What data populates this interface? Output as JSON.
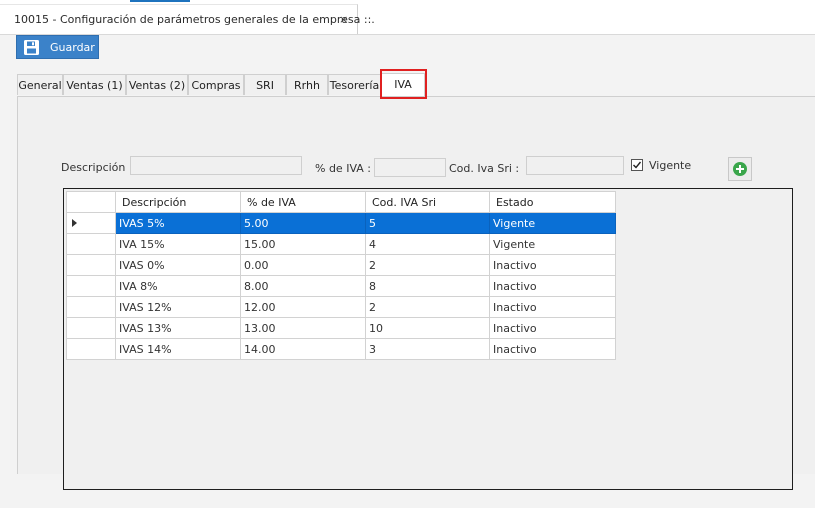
{
  "document_tab": {
    "title": "10015 - Configuración de parámetros generales de la empresa ::.",
    "close_glyph": "×"
  },
  "toolbar": {
    "save_label": "Guardar"
  },
  "tabs": [
    {
      "label": "General"
    },
    {
      "label": "Ventas (1)"
    },
    {
      "label": "Ventas (2)"
    },
    {
      "label": "Compras"
    },
    {
      "label": "SRI"
    },
    {
      "label": "Rrhh"
    },
    {
      "label": "Tesorería"
    },
    {
      "label": "IVA"
    }
  ],
  "active_tab": "IVA",
  "form": {
    "descripcion_label": "Descripción :",
    "descripcion_value": "",
    "iva_label": "% de IVA :",
    "iva_value": "",
    "cod_label": "Cod. Iva Sri :",
    "cod_value": "",
    "vigente_label": "Vigente",
    "vigente_checked": true
  },
  "grid": {
    "columns": [
      "Descripción",
      "% de IVA",
      "Cod. IVA Sri",
      "Estado"
    ],
    "rows": [
      {
        "descripcion": "IVAS 5%",
        "iva": "5.00",
        "cod": "5",
        "estado": "Vigente",
        "selected": true
      },
      {
        "descripcion": "IVA 15%",
        "iva": "15.00",
        "cod": "4",
        "estado": "Vigente",
        "selected": false
      },
      {
        "descripcion": "IVAS 0%",
        "iva": "0.00",
        "cod": "2",
        "estado": "Inactivo",
        "selected": false
      },
      {
        "descripcion": "IVA 8%",
        "iva": "8.00",
        "cod": "8",
        "estado": "Inactivo",
        "selected": false
      },
      {
        "descripcion": "IVAS 12%",
        "iva": "12.00",
        "cod": "2",
        "estado": "Inactivo",
        "selected": false
      },
      {
        "descripcion": "IVAS 13%",
        "iva": "13.00",
        "cod": "10",
        "estado": "Inactivo",
        "selected": false
      },
      {
        "descripcion": "IVAS 14%",
        "iva": "14.00",
        "cod": "3",
        "estado": "Inactivo",
        "selected": false
      }
    ]
  },
  "icons": {
    "save": "floppy-disk-icon",
    "add": "add-circle-icon",
    "row_indicator": "triangle-right-icon"
  },
  "colors": {
    "accent": "#3b82c9",
    "selection": "#0a70d6",
    "highlight_border": "#e02020",
    "add_green": "#3aa64b"
  }
}
